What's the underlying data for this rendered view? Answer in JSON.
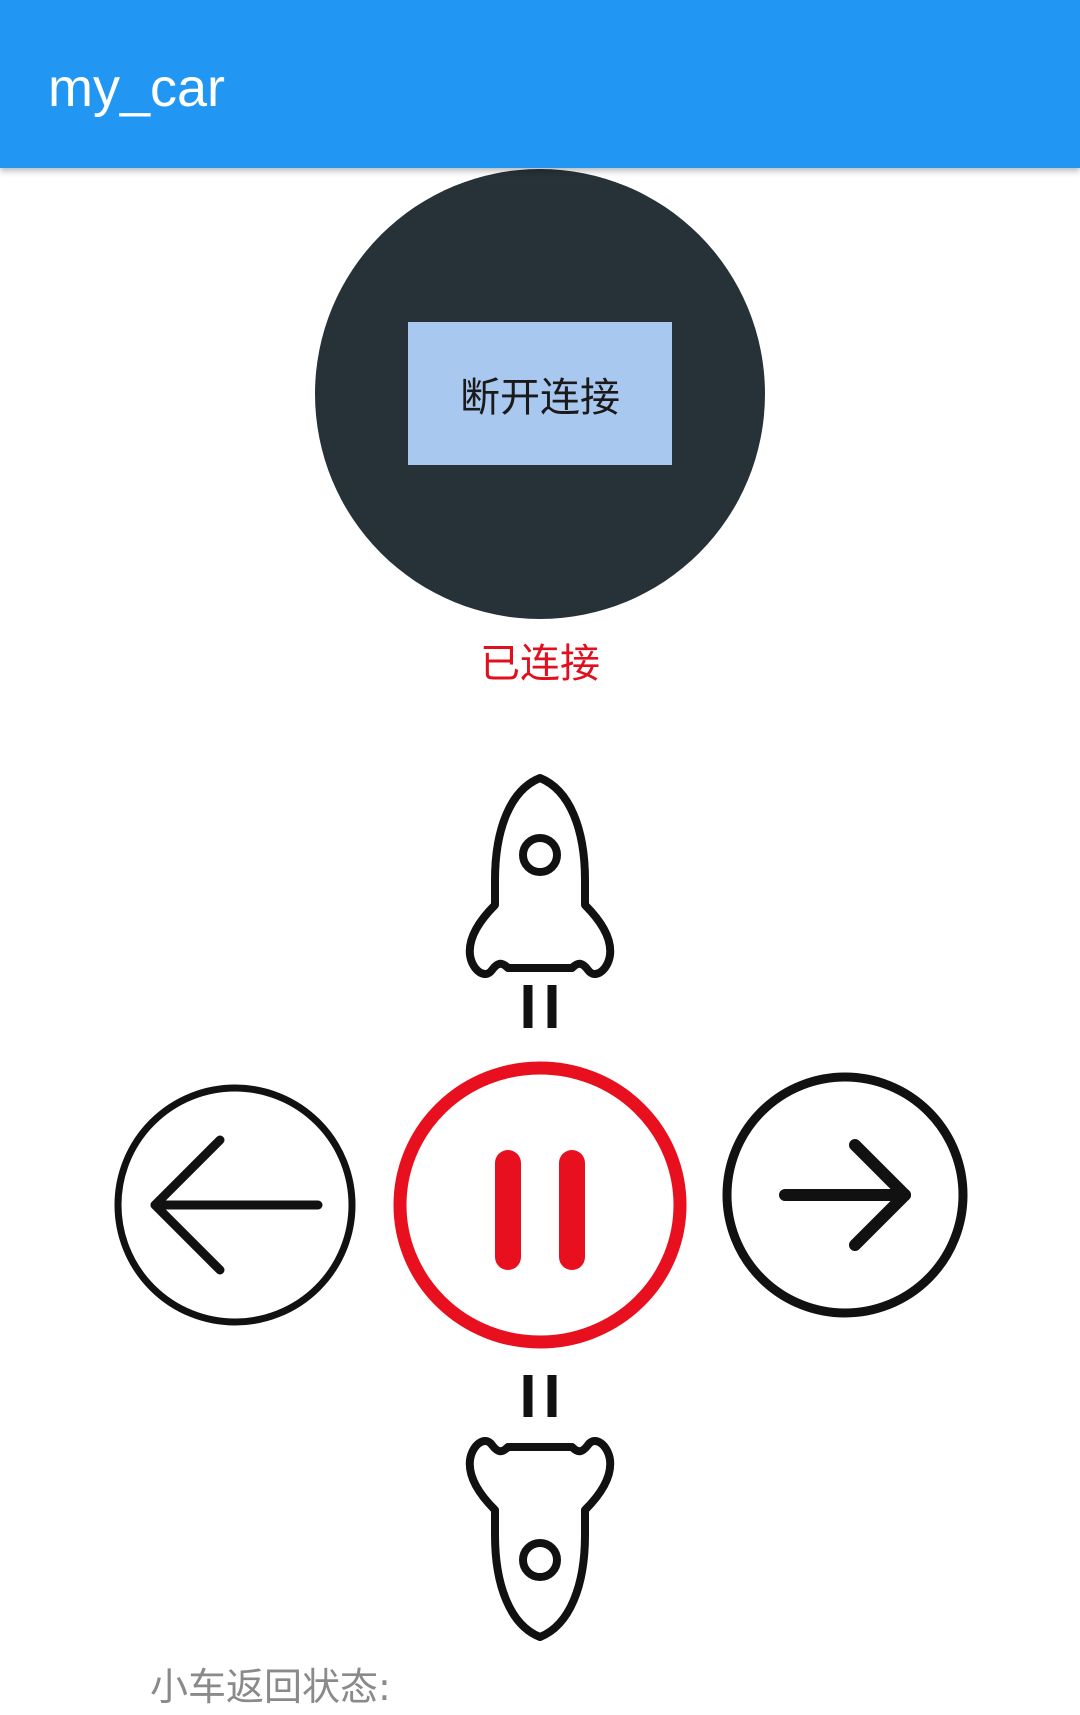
{
  "appbar": {
    "title": "my_car",
    "color": "#2196F3"
  },
  "connection": {
    "button_label": "断开连接",
    "status": "已连接",
    "status_color": "#E0101E",
    "circle_color": "#263238",
    "button_color": "#A9C8EF"
  },
  "controls": {
    "forward_icon": "rocket-up-icon",
    "backward_icon": "rocket-down-icon",
    "left_icon": "arrow-left-circle-icon",
    "right_icon": "arrow-right-circle-icon",
    "stop_icon": "pause-circle-icon",
    "stop_color": "#E8101E"
  },
  "car_status": {
    "label": "小车返回状态:"
  }
}
